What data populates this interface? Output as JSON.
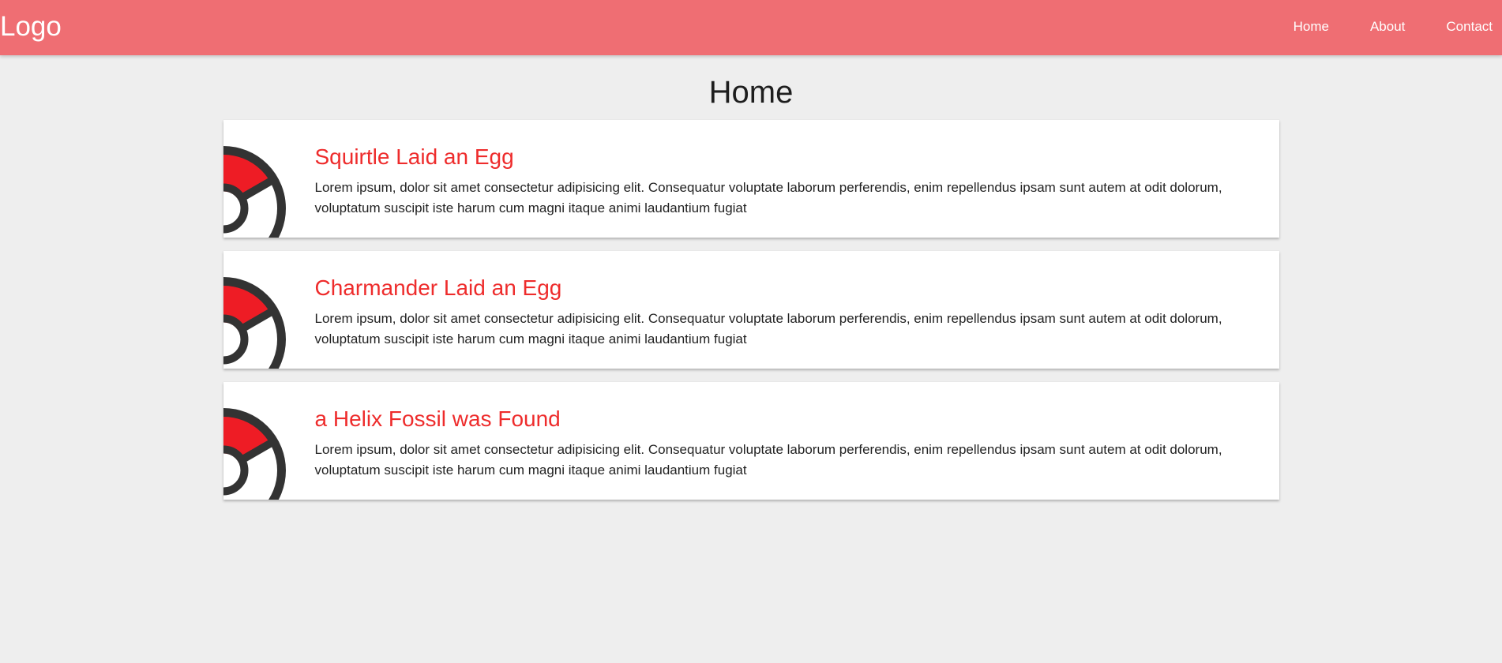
{
  "brand": {
    "logo": "Logo",
    "navbar_color": "#ef6e73"
  },
  "nav": {
    "items": [
      {
        "label": "Home"
      },
      {
        "label": "About"
      },
      {
        "label": "Contact"
      }
    ]
  },
  "main": {
    "title": "Home",
    "posts": [
      {
        "title": "Squirtle Laid an Egg",
        "body": "Lorem ipsum, dolor sit amet consectetur adipisicing elit. Consequatur voluptate laborum perferendis, enim repellendus ipsam sunt autem at odit dolorum, voluptatum suscipit iste harum cum magni itaque animi laudantium fugiat",
        "icon": "pokeball-icon"
      },
      {
        "title": "Charmander Laid an Egg",
        "body": "Lorem ipsum, dolor sit amet consectetur adipisicing elit. Consequatur voluptate laborum perferendis, enim repellendus ipsam sunt autem at odit dolorum, voluptatum suscipit iste harum cum magni itaque animi laudantium fugiat",
        "icon": "pokeball-icon"
      },
      {
        "title": "a Helix Fossil was Found",
        "body": "Lorem ipsum, dolor sit amet consectetur adipisicing elit. Consequatur voluptate laborum perferendis, enim repellendus ipsam sunt autem at odit dolorum, voluptatum suscipit iste harum cum magni itaque animi laudantium fugiat",
        "icon": "pokeball-icon"
      }
    ]
  },
  "colors": {
    "accent": "#ee2c2c",
    "background": "#eeeeee",
    "card": "#ffffff",
    "pokeball_red": "#ee1c25",
    "pokeball_outline": "#333333"
  }
}
